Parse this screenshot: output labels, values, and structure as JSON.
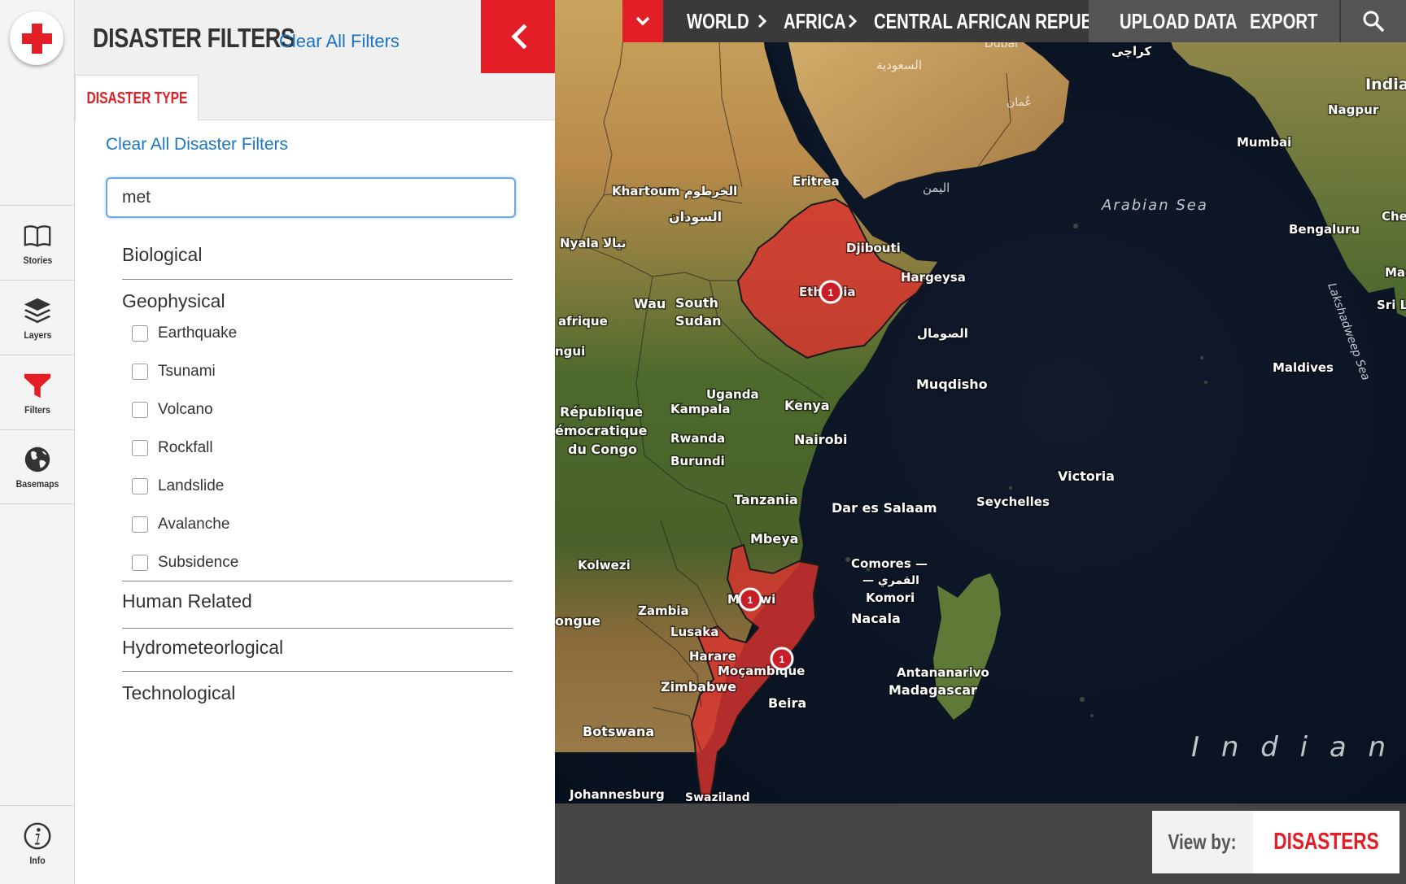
{
  "rail": {
    "items": [
      {
        "label": "Stories",
        "icon": "book-icon"
      },
      {
        "label": "Layers",
        "icon": "layers-icon"
      },
      {
        "label": "Filters",
        "icon": "funnel-icon"
      },
      {
        "label": "Basemaps",
        "icon": "globe-icon"
      }
    ],
    "info_label": "Info"
  },
  "panel": {
    "title": "DISASTER FILTERS",
    "clear_all": "Clear All Filters",
    "tab": "DISASTER TYPE",
    "clear_type": "Clear All Disaster Filters",
    "search_value": "met",
    "categories": [
      {
        "label": "Biological"
      },
      {
        "label": "Geophysical"
      },
      {
        "label": "Human Related"
      },
      {
        "label": "Hydrometeorlogical"
      },
      {
        "label": "Technological"
      }
    ],
    "geophysical_options": [
      {
        "label": "Earthquake",
        "checked": false
      },
      {
        "label": "Tsunami",
        "checked": false
      },
      {
        "label": "Volcano",
        "checked": false
      },
      {
        "label": "Rockfall",
        "checked": false
      },
      {
        "label": "Landslide",
        "checked": false
      },
      {
        "label": "Avalanche",
        "checked": false
      },
      {
        "label": "Subsidence",
        "checked": false
      }
    ]
  },
  "topbar": {
    "breadcrumbs": [
      "WORLD",
      "AFRICA",
      "CENTRAL AFRICAN REPUBLIC"
    ],
    "upload": "UPLOAD DATA",
    "export": "EXPORT"
  },
  "map": {
    "labels": {
      "dubai": "Dubai",
      "karachi": "كراچی",
      "india": "India",
      "nagpur": "Nagpur",
      "mumbai": "Mumbai",
      "saudi": "السعودية",
      "oman": "عُمان",
      "arabian_sea": "Arabian Sea",
      "bengaluru": "Bengaluru",
      "chennai": "Chen",
      "madras": "Mad",
      "srilanka": "Sri L",
      "eritrea": "Eritrea",
      "khartoum": "Khartoum الخرطوم",
      "sudan": "السودان",
      "yemen": "اليمن",
      "djibouti": "Djibouti",
      "hargeysa": "Hargeysa",
      "nyala": "Nyala نيالا",
      "ethiopia": "Ethiopia",
      "wau": "Wau",
      "south": "South",
      "sudan2": "Sudan",
      "afrique": "afrique",
      "somalia": "الصومال",
      "muqdisho": "Muqdisho",
      "maldives": "Maldives",
      "ngui": "ngui",
      "uganda": "Uganda",
      "kampala": "Kampala",
      "kenya": "Kenya",
      "republique": "République",
      "democratique": "émocratique",
      "congo": "du Congo",
      "rwanda": "Rwanda",
      "nairobi": "Nairobi",
      "burundi": "Burundi",
      "victoria": "Victoria",
      "seychelles": "Seychelles",
      "tanzania": "Tanzania",
      "dar": "Dar es Salaam",
      "mbeya": "Mbeya",
      "kolwezi": "Kolwezi",
      "comores": "Comores —",
      "comores2": "— القمري",
      "komori": "Komori",
      "malawi": "Malawi",
      "zambia": "Zambia",
      "nacala": "Nacala",
      "angola": "ongue",
      "lusaka": "Lusaka",
      "harare": "Harare",
      "mozambique": "Moçambique",
      "antananarivo": "Antananarivo",
      "madagascar": "Madagascar",
      "zimbabwe": "Zimbabwe",
      "beira": "Beira",
      "botswana": "Botswana",
      "indian": "I n d i a n",
      "johannesburg": "Johannesburg",
      "swaziland": "Swaziland",
      "lakshadweep": "Lakshadweep Sea"
    },
    "markers": [
      {
        "country": "Ethiopia",
        "count": "1"
      },
      {
        "country": "Malawi",
        "count": "1"
      },
      {
        "country": "Mozambique",
        "count": "1"
      }
    ]
  },
  "viewby": {
    "label": "View by:",
    "value": "DISASTERS"
  },
  "colors": {
    "accent": "#e41e26",
    "link": "#1a75c2"
  }
}
